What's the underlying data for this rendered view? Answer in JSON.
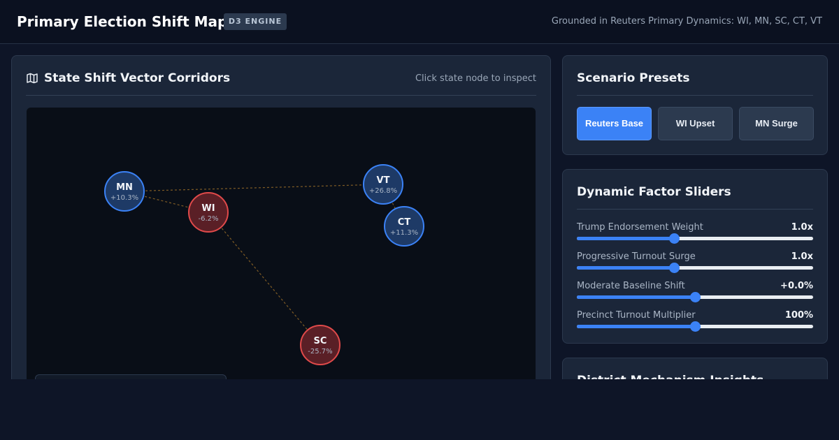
{
  "header": {
    "title": "Primary Election Shift Map",
    "badge": "D3 ENGINE",
    "subtitle": "Grounded in Reuters Primary Dynamics: WI, MN, SC, CT, VT"
  },
  "map_panel": {
    "title": "State Shift Vector Corridors",
    "icon": "map-icon",
    "hint": "Click state node to inspect",
    "states": [
      {
        "code": "MN",
        "shift": "+10.3%",
        "direction": "positive"
      },
      {
        "code": "WI",
        "shift": "-6.2%",
        "direction": "negative"
      },
      {
        "code": "VT",
        "shift": "+26.8%",
        "direction": "positive"
      },
      {
        "code": "CT",
        "shift": "+11.3%",
        "direction": "positive"
      },
      {
        "code": "SC",
        "shift": "-25.7%",
        "direction": "negative"
      }
    ],
    "corridors": [
      [
        "MN",
        "WI"
      ],
      [
        "MN",
        "VT"
      ],
      [
        "VT",
        "CT"
      ],
      [
        "WI",
        "SC"
      ]
    ],
    "colors": {
      "positive_fill": "#1e3a66",
      "positive_stroke": "#3b82f6",
      "negative_fill": "#5a1f26",
      "negative_stroke": "#e04a4a",
      "corridor": "#a8762a"
    }
  },
  "presets": {
    "title": "Scenario Presets",
    "buttons": [
      {
        "label": "Reuters Base",
        "active": true
      },
      {
        "label": "WI Upset",
        "active": false
      },
      {
        "label": "MN Surge",
        "active": false
      }
    ]
  },
  "sliders": {
    "title": "Dynamic Factor Sliders",
    "items": [
      {
        "label": "Trump Endorsement Weight",
        "value": "1.0x",
        "level": 0.41
      },
      {
        "label": "Progressive Turnout Surge",
        "value": "1.0x",
        "level": 0.41
      },
      {
        "label": "Moderate Baseline Shift",
        "value": "+0.0%",
        "level": 0.5
      },
      {
        "label": "Precinct Turnout Multiplier",
        "value": "100%",
        "level": 0.5
      }
    ]
  },
  "insights": {
    "title": "District Mechanism Insights"
  },
  "theme": {
    "accent": "#3b82f6",
    "background": "#0e1527",
    "card": "#1b2639"
  }
}
